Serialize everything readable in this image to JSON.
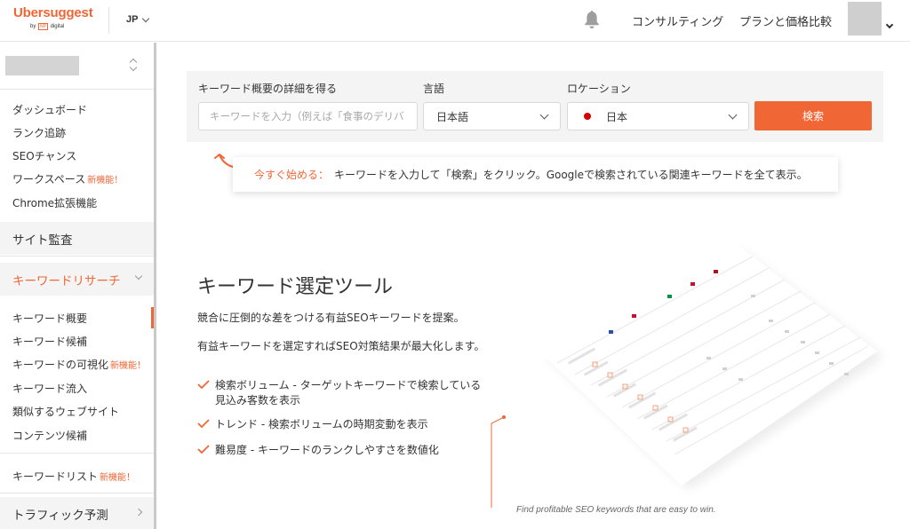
{
  "header": {
    "logo": "Ubersuggest",
    "logo_by": "by",
    "logo_np": "NP",
    "logo_brand": "digital",
    "language": "JP",
    "nav_consulting": "コンサルティング",
    "nav_pricing": "プランと価格比較",
    "icons": [
      "bell-icon",
      "chevron-down-icon"
    ]
  },
  "sidebar": {
    "items": [
      {
        "label": "ダッシュボード",
        "badge": ""
      },
      {
        "label": "ランク追跡",
        "badge": ""
      },
      {
        "label": "SEOチャンス",
        "badge": ""
      },
      {
        "label": "ワークスペース",
        "badge": "新機能！"
      },
      {
        "label": "Chrome拡張機能",
        "badge": ""
      }
    ],
    "site_audit": "サイト監査",
    "keyword_research": "キーワードリサーチ",
    "kr_items": [
      {
        "label": "キーワード概要",
        "badge": ""
      },
      {
        "label": "キーワード候補",
        "badge": ""
      },
      {
        "label": "キーワードの可視化",
        "badge": "新機能！"
      },
      {
        "label": "キーワード流入",
        "badge": ""
      },
      {
        "label": "類似するウェブサイト",
        "badge": ""
      },
      {
        "label": "コンテンツ候補",
        "badge": ""
      }
    ],
    "keyword_list": "キーワードリスト",
    "keyword_list_badge": "新機能！",
    "traffic": "トラフィック予測"
  },
  "search": {
    "keyword_label": "キーワード概要の詳細を得る",
    "keyword_placeholder": "キーワードを入力（例えば「食事のデリバ",
    "language_label": "言語",
    "language_value": "日本語",
    "location_label": "ロケーション",
    "location_value": "日本",
    "button": "検索"
  },
  "hint": {
    "lead": "今すぐ始める：",
    "text": "キーワードを入力して「検索」をクリック。Googleで検索されている関連キーワードを全て表示。"
  },
  "tool": {
    "title": "キーワード選定ツール",
    "p1": "競合に圧倒的な差をつける有益SEOキーワードを提案。",
    "p2": "有益キーワードを選定すればSEO対策結果が最大化します。",
    "features": [
      {
        "line1": "検索ボリューム - ターゲットキーワードで検索している",
        "line2": "見込み客数を表示"
      },
      {
        "line1": "トレンド - 検索ボリュームの時期変動を表示",
        "line2": ""
      },
      {
        "line1": "難易度 - キーワードのランクしやすさを数値化",
        "line2": ""
      }
    ],
    "caption": "Find profitable SEO keywords that are easy to win."
  },
  "colors": {
    "accent": "#f16635",
    "panel": "#f4f4f4",
    "flag_red": "#d40000"
  }
}
